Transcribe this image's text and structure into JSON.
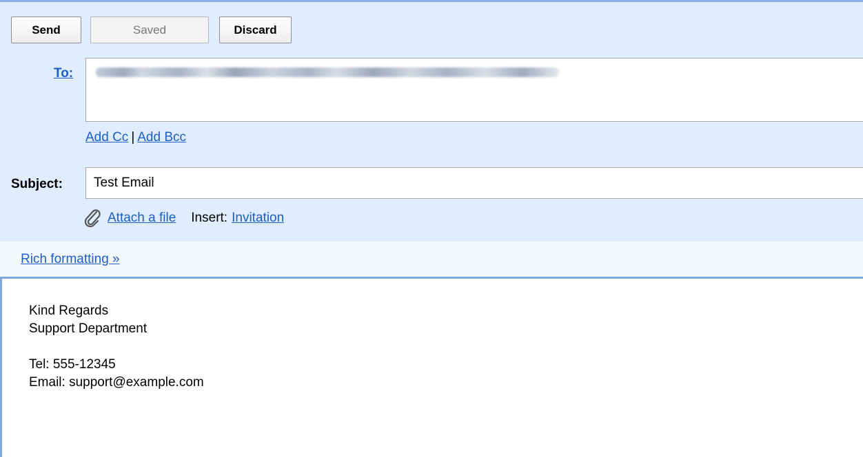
{
  "toolbar": {
    "send_label": "Send",
    "saved_label": "Saved",
    "discard_label": "Discard"
  },
  "to": {
    "label": "To:"
  },
  "cc": {
    "add_cc": "Add Cc",
    "separator": "|",
    "add_bcc": "Add Bcc"
  },
  "subject": {
    "label": "Subject:",
    "value": "Test Email"
  },
  "attach": {
    "icon": "paperclip-icon",
    "attach_label": "Attach a file",
    "insert_label": "Insert:",
    "invitation_label": "Invitation"
  },
  "rich": {
    "label": "Rich formatting »"
  },
  "body": {
    "lines": [
      "Kind Regards",
      "Support Department",
      "",
      "Tel: 555-12345",
      "Email: support@example.com"
    ]
  },
  "colors": {
    "compose_bg": "#e0ecff",
    "link": "#1b5fc7",
    "focus_border": "#7ea6e0"
  }
}
